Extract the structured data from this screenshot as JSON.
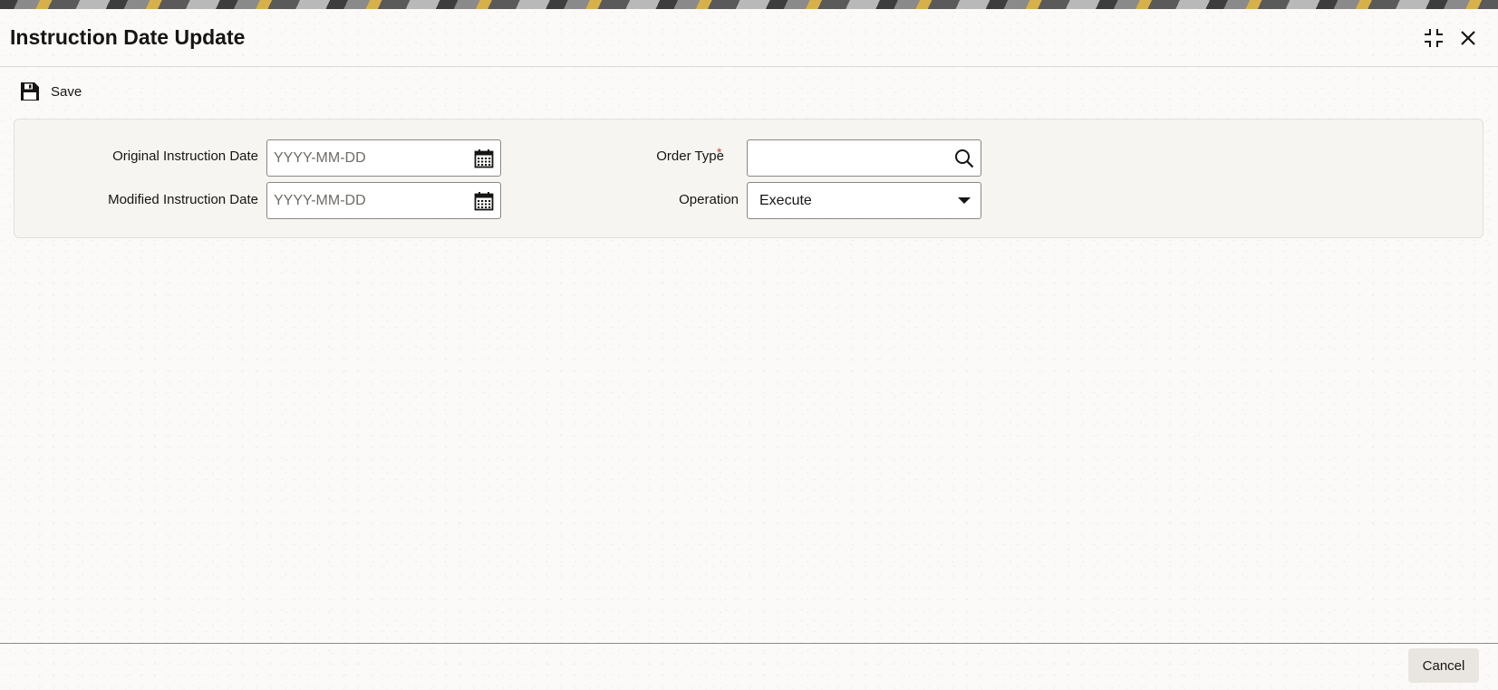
{
  "window": {
    "title": "Instruction Date Update",
    "expand_icon": "expand-icon",
    "close_icon": "close-icon"
  },
  "toolbar": {
    "save_label": "Save",
    "save_icon": "floppy-disk-icon"
  },
  "form": {
    "original_instruction_date": {
      "label": "Original Instruction Date",
      "placeholder": "YYYY-MM-DD",
      "value": "",
      "icon": "calendar-icon"
    },
    "modified_instruction_date": {
      "label": "Modified Instruction Date",
      "placeholder": "YYYY-MM-DD",
      "value": "",
      "icon": "calendar-icon"
    },
    "order_type": {
      "label": "Order Type",
      "required_marker": "*",
      "value": "",
      "icon": "search-icon"
    },
    "operation": {
      "label": "Operation",
      "selected": "Execute",
      "icon": "caret-down-icon"
    }
  },
  "footer": {
    "cancel_label": "Cancel"
  },
  "colors": {
    "required": "#c74634",
    "text": "#161513",
    "field_border": "#8a8682",
    "background": "#fbfaf8"
  }
}
